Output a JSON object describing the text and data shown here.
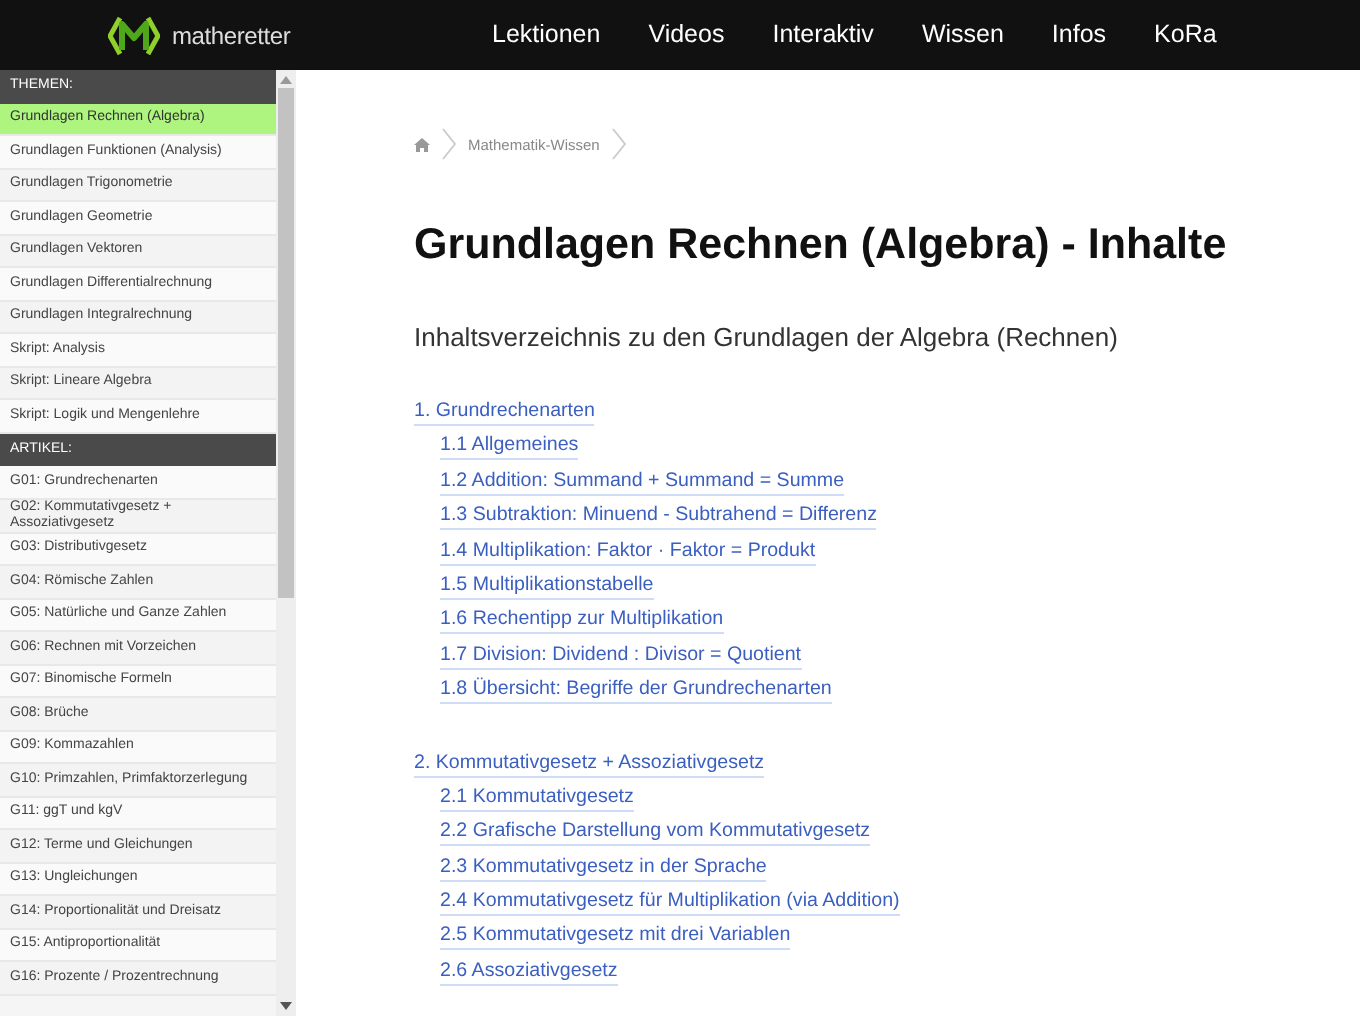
{
  "header": {
    "logo_text": "matheretter",
    "nav": [
      "Lektionen",
      "Videos",
      "Interaktiv",
      "Wissen",
      "Infos",
      "KoRa"
    ]
  },
  "sidebar": {
    "sections": [
      {
        "title": "THEMEN:",
        "items": [
          {
            "label": "Grundlagen Rechnen (Algebra)",
            "selected": true
          },
          {
            "label": "Grundlagen Funktionen (Analysis)",
            "selected": false
          },
          {
            "label": "Grundlagen Trigonometrie",
            "selected": false
          },
          {
            "label": "Grundlagen Geometrie",
            "selected": false
          },
          {
            "label": "Grundlagen Vektoren",
            "selected": false
          },
          {
            "label": "Grundlagen Differentialrechnung",
            "selected": false
          },
          {
            "label": "Grundlagen Integralrechnung",
            "selected": false
          },
          {
            "label": "Skript: Analysis",
            "selected": false
          },
          {
            "label": "Skript: Lineare Algebra",
            "selected": false
          },
          {
            "label": "Skript: Logik und Mengenlehre",
            "selected": false
          }
        ]
      },
      {
        "title": "ARTIKEL:",
        "items": [
          {
            "label": "G01: Grundrechenarten",
            "selected": false
          },
          {
            "label": "G02: Kommutativgesetz + Assoziativgesetz",
            "selected": false
          },
          {
            "label": "G03: Distributivgesetz",
            "selected": false
          },
          {
            "label": "G04: Römische Zahlen",
            "selected": false
          },
          {
            "label": "G05: Natürliche und Ganze Zahlen",
            "selected": false
          },
          {
            "label": "G06: Rechnen mit Vorzeichen",
            "selected": false
          },
          {
            "label": "G07: Binomische Formeln",
            "selected": false
          },
          {
            "label": "G08: Brüche",
            "selected": false
          },
          {
            "label": "G09: Kommazahlen",
            "selected": false
          },
          {
            "label": "G10: Primzahlen, Primfaktorzerlegung",
            "selected": false
          },
          {
            "label": "G11: ggT und kgV",
            "selected": false
          },
          {
            "label": "G12: Terme und Gleichungen",
            "selected": false
          },
          {
            "label": "G13: Ungleichungen",
            "selected": false
          },
          {
            "label": "G14: Proportionalität und Dreisatz",
            "selected": false
          },
          {
            "label": "G15: Antiproportionalität",
            "selected": false
          },
          {
            "label": "G16: Prozente / Prozentrechnung",
            "selected": false
          }
        ]
      }
    ]
  },
  "breadcrumb": [
    "Mathematik-Wissen"
  ],
  "title": "Grundlagen Rechnen (Algebra) - Inhalte",
  "subtitle": "Inhaltsverzeichnis zu den Grundlagen der Algebra (Rechnen)",
  "toc": [
    {
      "label": "1. Grundrechenarten",
      "children": [
        {
          "label": "1.1 Allgemeines"
        },
        {
          "label": "1.2 Addition: Summand + Summand = Summe"
        },
        {
          "label": "1.3 Subtraktion: Minuend - Subtrahend = Differenz"
        },
        {
          "label": "1.4 Multiplikation: Faktor · Faktor = Produkt"
        },
        {
          "label": "1.5 Multiplikationstabelle"
        },
        {
          "label": "1.6 Rechentipp zur Multiplikation"
        },
        {
          "label": "1.7 Division: Dividend : Divisor = Quotient"
        },
        {
          "label": "1.8 Übersicht: Begriffe der Grundrechenarten"
        }
      ]
    },
    {
      "label": "2. Kommutativgesetz + Assoziativgesetz",
      "children": [
        {
          "label": "2.1 Kommutativgesetz"
        },
        {
          "label": "2.2 Grafische Darstellung vom Kommutativgesetz"
        },
        {
          "label": "2.3 Kommutativgesetz in der Sprache"
        },
        {
          "label": "2.4 Kommutativgesetz für Multiplikation (via Addition)"
        },
        {
          "label": "2.5 Kommutativgesetz mit drei Variablen"
        },
        {
          "label": "2.6 Assoziativgesetz"
        }
      ]
    }
  ]
}
